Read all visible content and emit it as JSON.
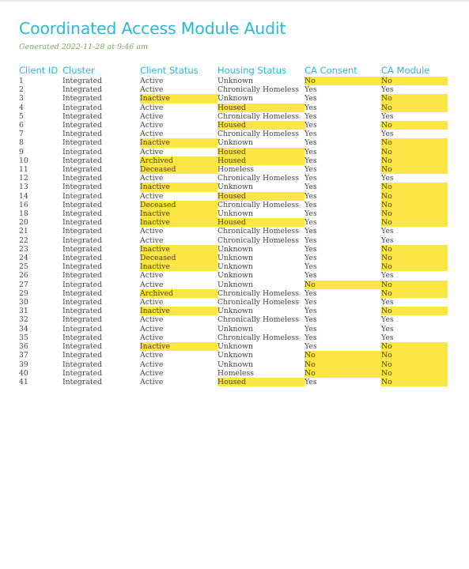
{
  "title": "Coordinated Access Module Audit",
  "generated": "Generated 2022-11-28 at  9:46 am",
  "highlight_color": "#fde544",
  "accent_color": "#2bb7d4",
  "columns": [
    "Client ID",
    "Cluster",
    "Client Status",
    "Housing Status",
    "CA Consent",
    "CA Module"
  ],
  "rows": [
    {
      "id": "1",
      "cluster": "Integrated",
      "status": "Active",
      "housing": "Unknown",
      "consent": "No",
      "module": "No"
    },
    {
      "id": "2",
      "cluster": "Integrated",
      "status": "Active",
      "housing": "Chronically Homeless",
      "consent": "Yes",
      "module": "Yes"
    },
    {
      "id": "3",
      "cluster": "Integrated",
      "status": "Inactive",
      "housing": "Unknown",
      "consent": "Yes",
      "module": "No"
    },
    {
      "id": "4",
      "cluster": "Integrated",
      "status": "Active",
      "housing": "Housed",
      "consent": "Yes",
      "module": "No"
    },
    {
      "id": "5",
      "cluster": "Integrated",
      "status": "Active",
      "housing": "Chronically Homeless",
      "consent": "Yes",
      "module": "Yes"
    },
    {
      "id": "6",
      "cluster": "Integrated",
      "status": "Active",
      "housing": "Housed",
      "consent": "Yes",
      "module": "No"
    },
    {
      "id": "7",
      "cluster": "Integrated",
      "status": "Active",
      "housing": "Chronically Homeless",
      "consent": "Yes",
      "module": "Yes"
    },
    {
      "id": "8",
      "cluster": "Integrated",
      "status": "Inactive",
      "housing": "Unknown",
      "consent": "Yes",
      "module": "No"
    },
    {
      "id": "9",
      "cluster": "Integrated",
      "status": "Active",
      "housing": "Housed",
      "consent": "Yes",
      "module": "No"
    },
    {
      "id": "10",
      "cluster": "Integrated",
      "status": "Archived",
      "housing": "Housed",
      "consent": "Yes",
      "module": "No"
    },
    {
      "id": "11",
      "cluster": "Integrated",
      "status": "Deceased",
      "housing": "Homeless",
      "consent": "Yes",
      "module": "No"
    },
    {
      "id": "12",
      "cluster": "Integrated",
      "status": "Active",
      "housing": "Chronically Homeless",
      "consent": "Yes",
      "module": "Yes"
    },
    {
      "id": "13",
      "cluster": "Integrated",
      "status": "Inactive",
      "housing": "Unknown",
      "consent": "Yes",
      "module": "No"
    },
    {
      "id": "14",
      "cluster": "Integrated",
      "status": "Active",
      "housing": "Housed",
      "consent": "Yes",
      "module": "No"
    },
    {
      "id": "16",
      "cluster": "Integrated",
      "status": "Deceased",
      "housing": "Chronically Homeless",
      "consent": "Yes",
      "module": "No"
    },
    {
      "id": "18",
      "cluster": "Integrated",
      "status": "Inactive",
      "housing": "Unknown",
      "consent": "Yes",
      "module": "No"
    },
    {
      "id": "20",
      "cluster": "Integrated",
      "status": "Inactive",
      "housing": "Housed",
      "consent": "Yes",
      "module": "No"
    },
    {
      "id": "21",
      "cluster": "Integrated",
      "status": "Active",
      "housing": "Chronically Homeless",
      "consent": "Yes",
      "module": "Yes"
    },
    {
      "id": "22",
      "cluster": "Integrated",
      "status": "Active",
      "housing": "Chronically Homeless",
      "consent": "Yes",
      "module": "Yes"
    },
    {
      "id": "23",
      "cluster": "Integrated",
      "status": "Inactive",
      "housing": "Unknown",
      "consent": "Yes",
      "module": "No"
    },
    {
      "id": "24",
      "cluster": "Integrated",
      "status": "Deceased",
      "housing": "Unknown",
      "consent": "Yes",
      "module": "No"
    },
    {
      "id": "25",
      "cluster": "Integrated",
      "status": "Inactive",
      "housing": "Unknown",
      "consent": "Yes",
      "module": "No"
    },
    {
      "id": "26",
      "cluster": "Integrated",
      "status": "Active",
      "housing": "Unknown",
      "consent": "Yes",
      "module": "Yes"
    },
    {
      "id": "27",
      "cluster": "Integrated",
      "status": "Active",
      "housing": "Unknown",
      "consent": "No",
      "module": "No"
    },
    {
      "id": "29",
      "cluster": "Integrated",
      "status": "Archived",
      "housing": "Chronically Homeless",
      "consent": "Yes",
      "module": "No"
    },
    {
      "id": "30",
      "cluster": "Integrated",
      "status": "Active",
      "housing": "Chronically Homeless",
      "consent": "Yes",
      "module": "Yes"
    },
    {
      "id": "31",
      "cluster": "Integrated",
      "status": "Inactive",
      "housing": "Unknown",
      "consent": "Yes",
      "module": "No"
    },
    {
      "id": "32",
      "cluster": "Integrated",
      "status": "Active",
      "housing": "Chronically Homeless",
      "consent": "Yes",
      "module": "Yes"
    },
    {
      "id": "34",
      "cluster": "Integrated",
      "status": "Active",
      "housing": "Unknown",
      "consent": "Yes",
      "module": "Yes"
    },
    {
      "id": "35",
      "cluster": "Integrated",
      "status": "Active",
      "housing": "Chronically Homeless",
      "consent": "Yes",
      "module": "Yes"
    },
    {
      "id": "36",
      "cluster": "Integrated",
      "status": "Inactive",
      "housing": "Unknown",
      "consent": "Yes",
      "module": "No"
    },
    {
      "id": "37",
      "cluster": "Integrated",
      "status": "Active",
      "housing": "Unknown",
      "consent": "No",
      "module": "No"
    },
    {
      "id": "39",
      "cluster": "Integrated",
      "status": "Active",
      "housing": "Unknown",
      "consent": "No",
      "module": "No"
    },
    {
      "id": "40",
      "cluster": "Integrated",
      "status": "Active",
      "housing": "Homeless",
      "consent": "No",
      "module": "No"
    },
    {
      "id": "41",
      "cluster": "Integrated",
      "status": "Active",
      "housing": "Housed",
      "consent": "Yes",
      "module": "No"
    }
  ],
  "highlight_rules": {
    "status": [
      "Inactive",
      "Archived",
      "Deceased"
    ],
    "housing": [
      "Housed"
    ],
    "consent": [
      "No"
    ],
    "module": [
      "No"
    ]
  }
}
